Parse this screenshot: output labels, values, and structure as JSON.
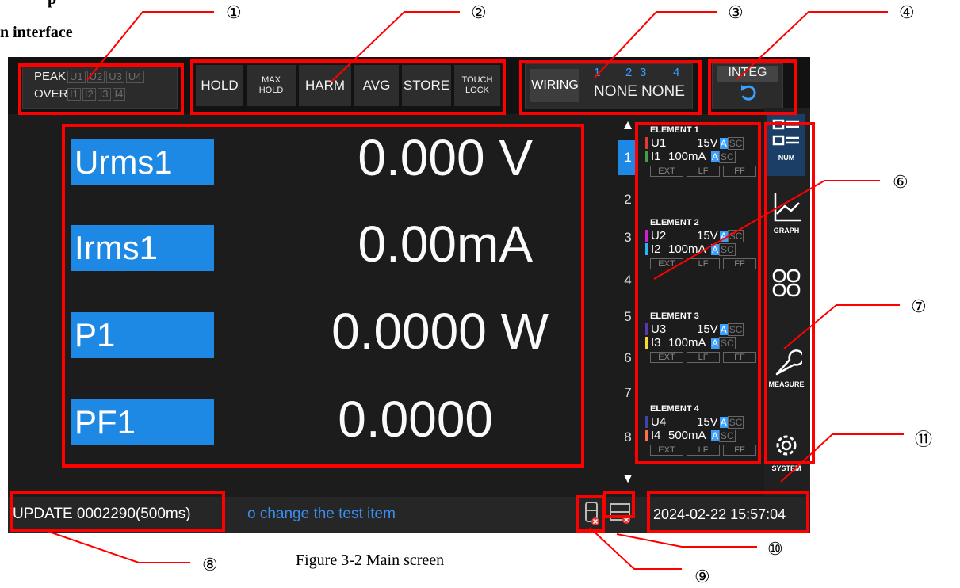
{
  "document": {
    "heading_top": "p",
    "heading": "n interface",
    "caption": "Figure 3-2 Main screen",
    "callouts": [
      "①",
      "②",
      "③",
      "④",
      "⑥",
      "⑦",
      "⑧",
      "⑨",
      "⑩",
      "⑪"
    ]
  },
  "peak_over": {
    "peak_label": "PEAK",
    "over_label": "OVER",
    "u_indicators": [
      "U1",
      "U2",
      "U3",
      "U4"
    ],
    "i_indicators": [
      "I1",
      "I2",
      "I3",
      "I4"
    ]
  },
  "toolbar": {
    "hold": "HOLD",
    "max_hold_1": "MAX",
    "max_hold_2": "HOLD",
    "harm": "HARM",
    "avg": "AVG",
    "store": "STORE",
    "touch_lock_1": "TOUCH",
    "touch_lock_2": "LOCK"
  },
  "wiring": {
    "label": "WIRING",
    "nums": [
      "1",
      "2",
      "3",
      "4"
    ],
    "values": [
      "NONE",
      "NONE"
    ]
  },
  "integ": {
    "label": "INTEG",
    "icon": "reset-arrow-icon"
  },
  "measurements": [
    {
      "label": "Urms1",
      "value": "0.000 V"
    },
    {
      "label": "Irms1",
      "value": "0.00mA"
    },
    {
      "label": "P1",
      "value": "0.0000 W"
    },
    {
      "label": "PF1",
      "value": "0.0000"
    }
  ],
  "page_index": {
    "up": "▲",
    "down": "▼",
    "items": [
      "1",
      "2",
      "3",
      "4",
      "5",
      "6",
      "7",
      "8"
    ],
    "active": "1"
  },
  "elements": [
    {
      "title": "ELEMENT 1",
      "u_name": "U1",
      "u_range": "15V",
      "i_name": "I1",
      "i_range": "100mA",
      "u_color": "#e53935",
      "i_color": "#43a047"
    },
    {
      "title": "ELEMENT 2",
      "u_name": "U2",
      "u_range": "15V",
      "i_name": "I2",
      "i_range": "100mA",
      "u_color": "#d81bd8",
      "i_color": "#29b6f6"
    },
    {
      "title": "ELEMENT 3",
      "u_name": "U3",
      "u_range": "15V",
      "i_name": "I3",
      "i_range": "100mA",
      "u_color": "#5e35b1",
      "i_color": "#fdd835"
    },
    {
      "title": "ELEMENT 4",
      "u_name": "U4",
      "u_range": "15V",
      "i_name": "I4",
      "i_range": "500mA",
      "u_color": "#3949ab",
      "i_color": "#ff7043"
    }
  ],
  "element_badges": {
    "auto": "A",
    "sc": "SC",
    "ext": "EXT",
    "lf": "LF",
    "ff": "FF"
  },
  "side_menu": [
    {
      "label": "NUM",
      "icon": "num-list-icon"
    },
    {
      "label": "GRAPH",
      "icon": "graph-icon"
    },
    {
      "label": "",
      "icon": "grid-icon"
    },
    {
      "label": "MEASURE",
      "icon": "wrench-icon"
    },
    {
      "label": "SYSTEM",
      "icon": "gear-icon"
    }
  ],
  "status": {
    "update": "UPDATE 0002290(500ms)",
    "hint": "o change the test item",
    "datetime": "2024-02-22 15:57:04"
  },
  "colors": {
    "highlight": "#ff0000",
    "accent": "#1e88e5",
    "screen_bg": "#1c1c1c"
  }
}
